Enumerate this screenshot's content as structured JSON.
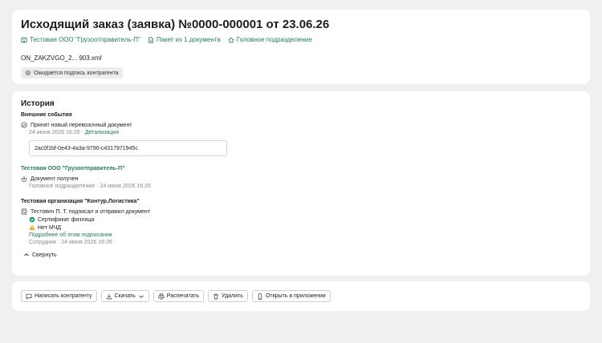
{
  "header": {
    "title": "Исходящий заказ (заявка) №0000-000001 от 23.06.26",
    "meta": {
      "organization": "Тестовая ООО \"Грузоотправитель-П\"",
      "package": "Пакет из 1 документа",
      "division": "Головное подразделение"
    },
    "file_name": "ON_ZAKZVGO_2... 903.xml",
    "status": "Ожидается подпись контрагента"
  },
  "history": {
    "title": "История",
    "external_label": "Внешние события",
    "event1": {
      "text": "Принят новый перевозочный документ",
      "date": "24 июня 2026 16:26",
      "separator": "·",
      "link": "Детализация",
      "hash": "2ac0f1bf-0e43-4a3a-9790-c4317971945c"
    },
    "org1": "Тестовая ООО \"Грузоотправитель-П\"",
    "event2": {
      "text": "Документ получен",
      "sub": "Головное подразделение · 24 июня 2026 16:26"
    },
    "org2": "Тестовая организация \"Контур.Логистика\"",
    "event3": {
      "text": "Тестович П. Т. подписал и отправил документ",
      "cert": "Сертификат физлица",
      "mchd": "Нет МЧД",
      "link": "Подробнее об этом подписании",
      "sub": "Сотрудник · 24 июня 2026 16:26"
    },
    "collapse": "Свернуть"
  },
  "actions": {
    "write": "Написать контрагенту",
    "download": "Скачать",
    "print": "Распечатать",
    "delete": "Удалить",
    "open_app": "Открыть в приложении"
  },
  "colors": {
    "accent": "#1f7c5c",
    "success": "#1fa463",
    "warning": "#f2a20c"
  }
}
